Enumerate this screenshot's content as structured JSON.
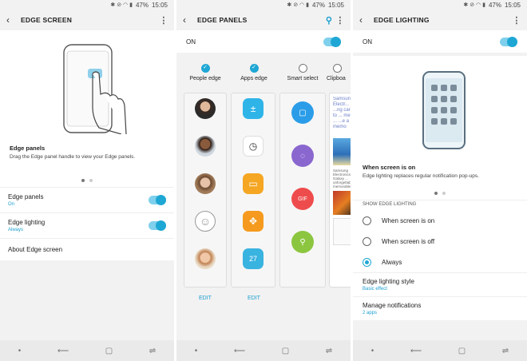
{
  "status": {
    "time": "15:05",
    "battery": "47%"
  },
  "edge_screen": {
    "title": "EDGE SCREEN",
    "heading": "Edge panels",
    "desc": "Drag the Edge panel handle to view your Edge panels.",
    "items": [
      {
        "label": "Edge panels",
        "sub": "On",
        "toggle": true
      },
      {
        "label": "Edge lighting",
        "sub": "Always",
        "toggle": true
      },
      {
        "label": "About Edge screen",
        "sub": ""
      }
    ]
  },
  "edge_panels": {
    "title": "EDGE PANELS",
    "on_label": "ON",
    "panels": [
      {
        "label": "People edge",
        "checked": true,
        "edit": "EDIT"
      },
      {
        "label": "Apps edge",
        "checked": true,
        "edit": "EDIT"
      },
      {
        "label": "Smart select",
        "checked": false
      },
      {
        "label": "Clipboa",
        "checked": false
      }
    ],
    "clip_text": "Samsung Electr... ...ng care to ... memo ... ...e a memo",
    "clip_news": "Samsung Electronics Galaxy ... unforgettable memorable experiences"
  },
  "edge_lighting": {
    "title": "EDGE LIGHTING",
    "on_label": "ON",
    "heading": "When screen is on",
    "desc": "Edge lighting replaces regular notification pop-ups.",
    "section": "SHOW EDGE LIGHTING",
    "options": [
      {
        "label": "When screen is on",
        "selected": false
      },
      {
        "label": "When screen is off",
        "selected": false
      },
      {
        "label": "Always",
        "selected": true
      }
    ],
    "style_label": "Edge lighting style",
    "style_sub": "Basic effect",
    "notif_label": "Manage notifications",
    "notif_sub": "2 apps"
  },
  "colors": {
    "accent": "#1ea7d4",
    "link": "#1b9fd0"
  }
}
